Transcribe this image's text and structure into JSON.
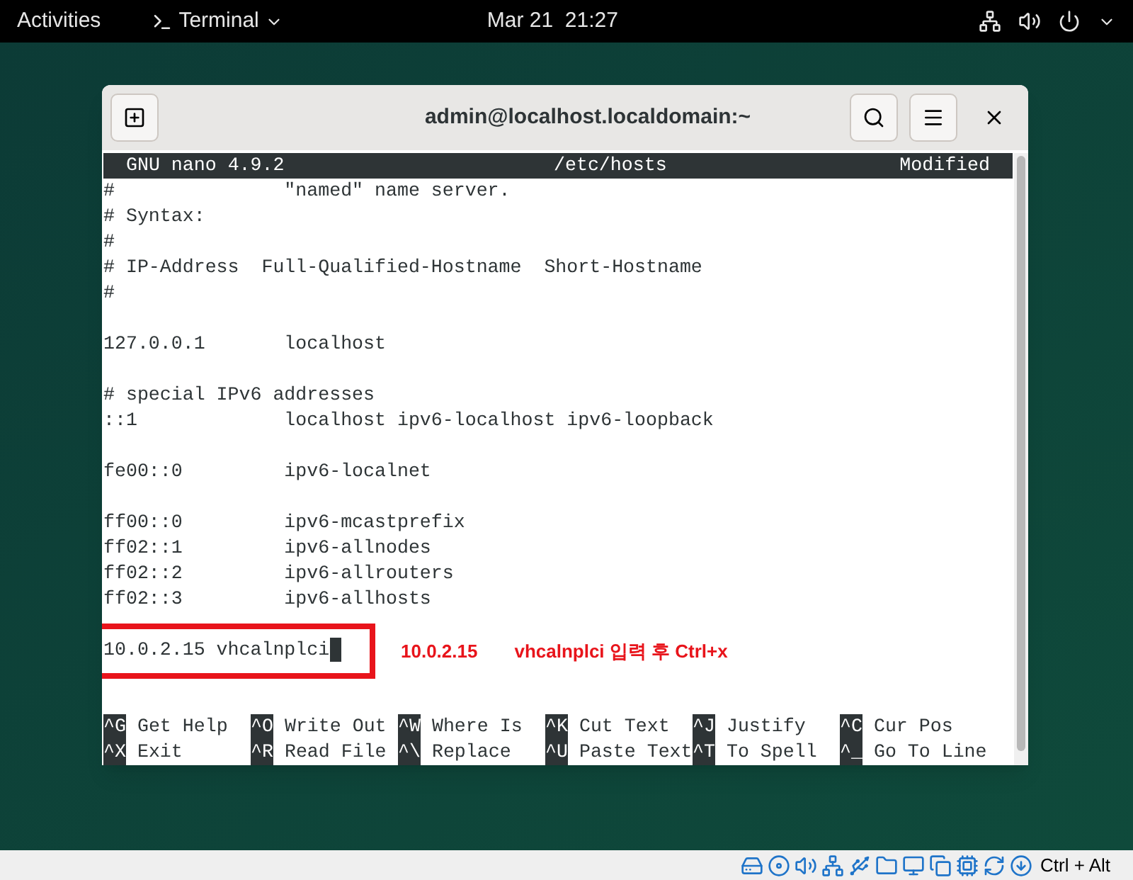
{
  "top_bar": {
    "activities": "Activities",
    "app_menu": "Terminal",
    "clock": "Mar 21  21:27"
  },
  "window": {
    "title": "admin@localhost.localdomain:~"
  },
  "nano": {
    "version": "GNU nano 4.9.2",
    "file": "/etc/hosts",
    "status": "Modified",
    "blocks": [
      [
        "#               \"named\" name server.",
        "# Syntax:",
        "#",
        "# IP-Address  Full-Qualified-Hostname  Short-Hostname",
        "#"
      ],
      [
        "127.0.0.1       localhost"
      ],
      [
        "# special IPv6 addresses",
        "::1             localhost ipv6-localhost ipv6-loopback"
      ],
      [
        "fe00::0         ipv6-localnet"
      ],
      [
        "ff00::0         ipv6-mcastprefix",
        "ff02::1         ipv6-allnodes",
        "ff02::2         ipv6-allrouters",
        "ff02::3         ipv6-allhosts"
      ],
      [
        "10.0.2.15 vhcalnplci"
      ]
    ],
    "shortcuts": [
      [
        {
          "key": "^G",
          "label": "Get Help"
        },
        {
          "key": "^O",
          "label": "Write Out"
        },
        {
          "key": "^W",
          "label": "Where Is"
        },
        {
          "key": "^K",
          "label": "Cut Text"
        },
        {
          "key": "^J",
          "label": "Justify"
        },
        {
          "key": "^C",
          "label": "Cur Pos"
        }
      ],
      [
        {
          "key": "^X",
          "label": "Exit"
        },
        {
          "key": "^R",
          "label": "Read File"
        },
        {
          "key": "^\\",
          "label": "Replace"
        },
        {
          "key": "^U",
          "label": "Paste Text"
        },
        {
          "key": "^T",
          "label": "To Spell"
        },
        {
          "key": "^_",
          "label": "Go To Line"
        }
      ]
    ]
  },
  "annotation": {
    "ip": "10.0.2.15",
    "instruction": "vhcalnplci 입력 후 Ctrl+x"
  },
  "vm_status_bar": {
    "host_key": "Ctrl + Alt"
  }
}
